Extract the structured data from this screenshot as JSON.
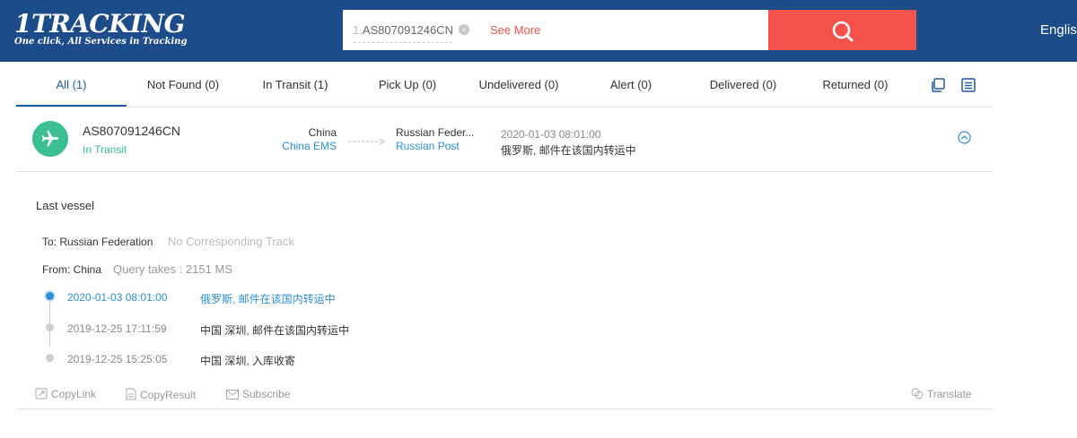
{
  "header": {
    "brand": "1TRACKING",
    "tagline": "One click, All Services in Tracking",
    "search_index": "1.",
    "search_value": "AS807091246CN",
    "see_more": "See More",
    "language": "English"
  },
  "tabs": [
    {
      "label": "All (1)",
      "active": true
    },
    {
      "label": "Not Found (0)"
    },
    {
      "label": "In Transit (1)"
    },
    {
      "label": "Pick Up (0)"
    },
    {
      "label": "Undelivered (0)"
    },
    {
      "label": "Alert (0)"
    },
    {
      "label": "Delivered (0)"
    },
    {
      "label": "Returned (0)"
    }
  ],
  "result": {
    "tracking_number": "AS807091246CN",
    "status": "In Transit",
    "origin_country": "China",
    "origin_carrier": "China EMS",
    "dest_country": "Russian Feder...",
    "dest_carrier": "Russian Post",
    "last_time": "2020-01-03 08:01:00",
    "last_event": "俄罗斯, 邮件在该国内转运中"
  },
  "detail": {
    "title": "Last vessel",
    "to_label": "To: Russian Federation",
    "to_note": "No Corresponding Track",
    "from_label": "From: China",
    "from_note": "Query takes : 2151 MS",
    "events": [
      {
        "time": "2020-01-03 08:01:00",
        "desc": "俄罗斯, 邮件在该国内转运中"
      },
      {
        "time": "2019-12-25 17:11:59",
        "desc": "中国 深圳, 邮件在该国内转运中"
      },
      {
        "time": "2019-12-25 15:25:05",
        "desc": "中国 深圳, 入库收寄"
      }
    ]
  },
  "actions": {
    "copy_link": "CopyLink",
    "copy_result": "CopyResult",
    "subscribe": "Subscribe",
    "translate": "Translate"
  },
  "colors": {
    "header_bg": "#1d4c8a",
    "accent_red": "#f4524b",
    "status_green": "#3dbf96",
    "link_blue": "#2d8fd6"
  }
}
